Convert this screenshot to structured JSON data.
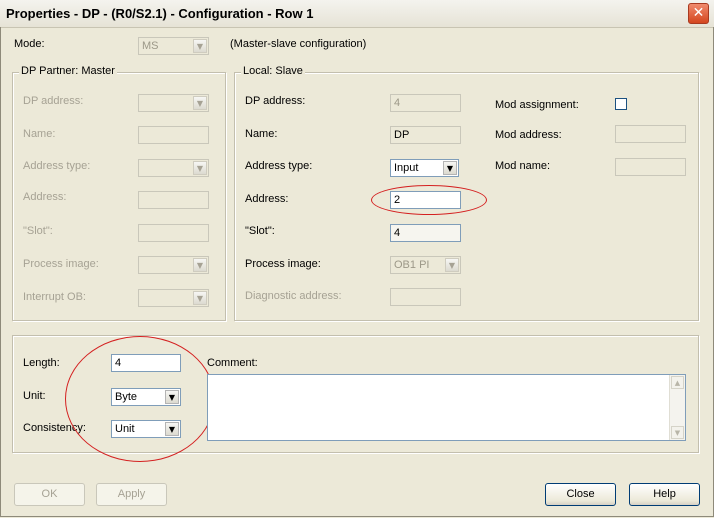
{
  "window": {
    "title": "Properties - DP - (R0/S2.1) - Configuration - Row 1",
    "close_glyph": "✕"
  },
  "mode": {
    "label": "Mode:",
    "value": "MS",
    "description": "(Master-slave configuration)"
  },
  "dp_partner": {
    "legend": "DP Partner: Master",
    "dp_address_label": "DP address:",
    "name_label": "Name:",
    "address_type_label": "Address type:",
    "address_label": "Address:",
    "slot_label": "\"Slot\":",
    "process_image_label": "Process image:",
    "interrupt_ob_label": "Interrupt OB:"
  },
  "local_slave": {
    "legend": "Local: Slave",
    "dp_address_label": "DP address:",
    "dp_address_value": "4",
    "name_label": "Name:",
    "name_value": "DP",
    "address_type_label": "Address type:",
    "address_type_value": "Input",
    "address_label": "Address:",
    "address_value": "2",
    "slot_label": "\"Slot\":",
    "slot_value": "4",
    "process_image_label": "Process image:",
    "process_image_value": "OB1 PI",
    "diagnostic_address_label": "Diagnostic address:",
    "mod_assignment_label": "Mod assignment:",
    "mod_address_label": "Mod address:",
    "mod_name_label": "Mod name:"
  },
  "config": {
    "length_label": "Length:",
    "length_value": "4",
    "unit_label": "Unit:",
    "unit_value": "Byte",
    "consistency_label": "Consistency:",
    "consistency_value": "Unit",
    "comment_label": "Comment:"
  },
  "buttons": {
    "ok": "OK",
    "apply": "Apply",
    "close": "Close",
    "help": "Help"
  },
  "icons": {
    "dropdown_arrow": "▼",
    "scroll_up": "▲",
    "scroll_down": "▼"
  },
  "colors": {
    "annotation_circle": "#d42020",
    "dialog_bg": "#ece9d8",
    "close_button": "#d4461f"
  }
}
